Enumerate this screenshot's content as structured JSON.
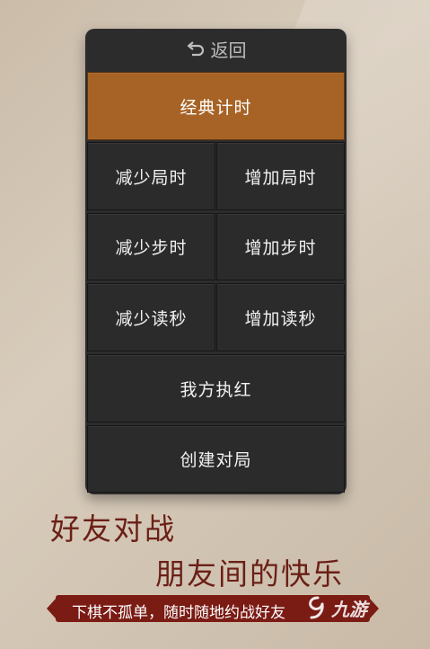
{
  "header": {
    "back_label": "返回"
  },
  "buttons": {
    "classic_timing": "经典计时",
    "decrease_game_time": "减少局时",
    "increase_game_time": "增加局时",
    "decrease_step_time": "减少步时",
    "increase_step_time": "增加步时",
    "decrease_countdown": "减少读秒",
    "increase_countdown": "增加读秒",
    "play_red": "我方执红",
    "create_game": "创建对局"
  },
  "promo": {
    "line1": "好友对战",
    "line2": "朋友间的快乐",
    "ribbon": "下棋不孤单，随时随地约战好友"
  },
  "watermark": {
    "text": "九游",
    "icon": "nine-game-logo-icon"
  },
  "colors": {
    "accent": "#a76326",
    "panel": "#2c2c2c",
    "promo_text": "#6b1f16",
    "ribbon": "#7a1b14"
  }
}
